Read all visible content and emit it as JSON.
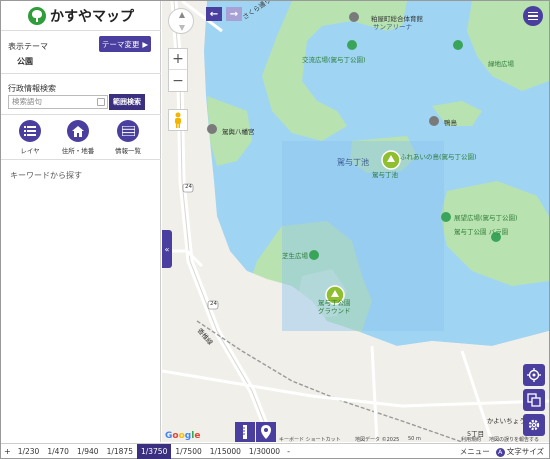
{
  "app": {
    "title": "かすやマップ"
  },
  "sidebar": {
    "theme_label": "表示テーマ",
    "theme_button": "テーマ変更",
    "theme_value": "公園",
    "admin_search_label": "行政情報検索",
    "search_placeholder": "検索語句",
    "range_search": "範囲検索",
    "tools": [
      {
        "label": "レイヤ",
        "icon": "layers-list-icon"
      },
      {
        "label": "住所・地番",
        "icon": "house-icon"
      },
      {
        "label": "情報一覧",
        "icon": "list-table-icon"
      }
    ],
    "keyword_label": "キーワードから探す",
    "collapse": "«"
  },
  "map": {
    "labels": {
      "gym": "粕屋町総合体育館",
      "sunarena": "サンアリーナ",
      "exchange_plaza": "交流広場(駕与丁公園)",
      "green_plaza": "緑地広場",
      "shrine": "駕輿八幡宮",
      "kamome": "鴨島",
      "pond": "駕与丁池",
      "pond_sub": "駕与丁池",
      "island": "ふれあいの島(駕与丁公園)",
      "lookout": "展望広場(駕与丁公園)",
      "rose_garden": "駕与丁公園 バラ園",
      "lawn_plaza": "芝生広場",
      "park_ground": "駕与丁公園",
      "park_ground2": "グラウンド",
      "road24a": "24",
      "road24b": "24",
      "sakura": "さくら通り",
      "station_line": "香椎線",
      "kayoi": "かよいちょう",
      "town": "5丁目"
    },
    "attribution": {
      "google": "Google",
      "shortcuts": "キーボード ショートカット",
      "map_data": "地図データ ©2025",
      "scale": "50 m",
      "terms": "利用規約",
      "report": "地図の誤りを報告する"
    }
  },
  "scalebar": {
    "plus": "+",
    "scales": [
      "1/230",
      "1/470",
      "1/940",
      "1/1875",
      "1/3750",
      "1/7500",
      "1/15000",
      "1/30000"
    ],
    "active": "1/3750",
    "minus": "-",
    "menu": "メニュー",
    "font_size": "文字サイズ"
  },
  "colors": {
    "accent": "#4a3f9e",
    "water": "#9fd5f2",
    "park": "#b8e3b0",
    "selection": "#8fc4ef"
  }
}
